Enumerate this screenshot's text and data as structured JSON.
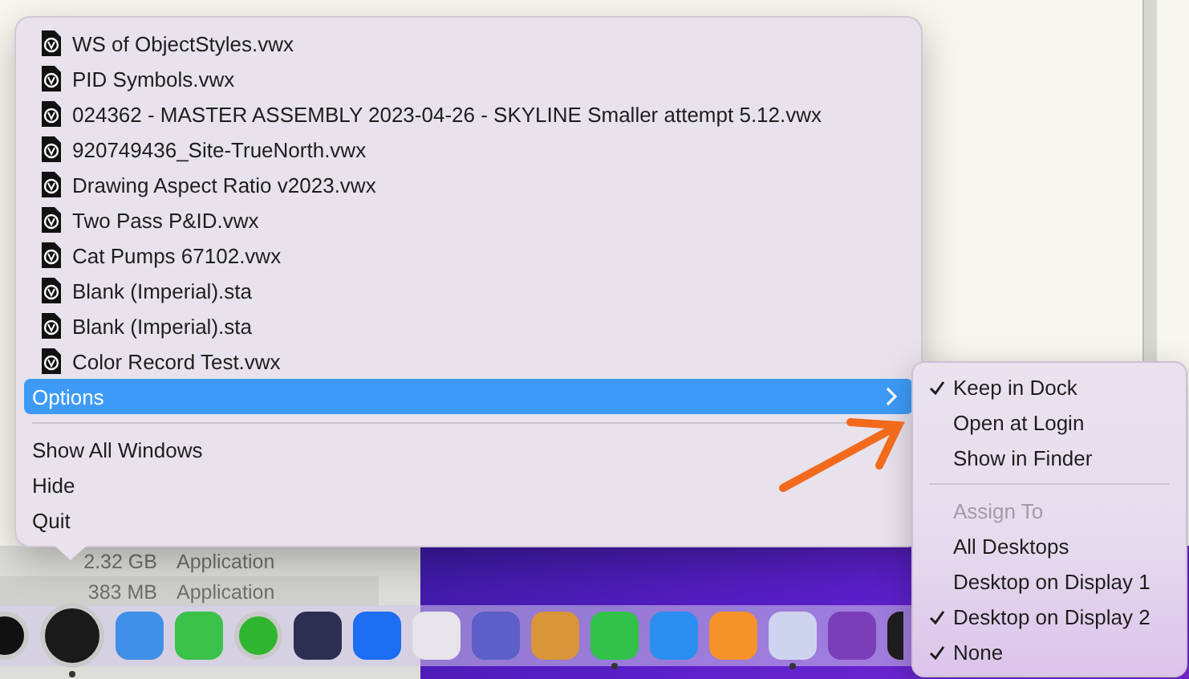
{
  "menu": {
    "recent_files": [
      {
        "label": "WS of ObjectStyles.vwx"
      },
      {
        "label": "PID Symbols.vwx"
      },
      {
        "label": "024362 - MASTER ASSEMBLY 2023-04-26 - SKYLINE Smaller attempt 5.12.vwx"
      },
      {
        "label": "920749436_Site-TrueNorth.vwx"
      },
      {
        "label": "Drawing Aspect Ratio v2023.vwx"
      },
      {
        "label": "Two Pass P&ID.vwx"
      },
      {
        "label": "Cat Pumps 67102.vwx"
      },
      {
        "label": "Blank (Imperial).sta"
      },
      {
        "label": "Blank (Imperial).sta"
      },
      {
        "label": "Color Record Test.vwx"
      }
    ],
    "options": {
      "label": "Options",
      "selected": true
    },
    "commands": [
      {
        "label": "Show All Windows"
      },
      {
        "label": "Hide"
      },
      {
        "label": "Quit"
      }
    ]
  },
  "submenu": {
    "items": [
      {
        "label": "Keep in Dock",
        "checked": true
      },
      {
        "label": "Open at Login",
        "checked": false
      },
      {
        "label": "Show in Finder",
        "checked": false
      }
    ],
    "section_header": "Assign To",
    "desktops": [
      {
        "label": "All Desktops",
        "checked": false
      },
      {
        "label": "Desktop on Display 1",
        "checked": false
      },
      {
        "label": "Desktop on Display 2",
        "checked": true
      },
      {
        "label": "None",
        "checked": true
      }
    ]
  },
  "finder_rows": [
    {
      "size": "2.32 GB",
      "kind": "Application"
    },
    {
      "size": "383 MB",
      "kind": "Application"
    }
  ],
  "dock": [
    {
      "kind": "disc",
      "color": "#111111",
      "running": false
    },
    {
      "kind": "disc",
      "color": "#1a1a1a",
      "running": true
    },
    {
      "kind": "tile",
      "color": "#3f8fe8",
      "running": false
    },
    {
      "kind": "tile",
      "color": "#3ac24a",
      "running": false
    },
    {
      "kind": "blob",
      "color": "#2fb52f",
      "running": false
    },
    {
      "kind": "tile",
      "color": "#2d2f52",
      "running": false
    },
    {
      "kind": "tile",
      "color": "#1c6df2",
      "running": false
    },
    {
      "kind": "tile",
      "color": "#e8e4ec",
      "running": false
    },
    {
      "kind": "tile",
      "color": "#5b5fc7",
      "running": false
    },
    {
      "kind": "tile",
      "color": "#d9953a",
      "running": false
    },
    {
      "kind": "tile",
      "color": "#31c24a",
      "running": true
    },
    {
      "kind": "tile",
      "color": "#2a8ff0",
      "running": false
    },
    {
      "kind": "tile",
      "color": "#f5922a",
      "running": false
    },
    {
      "kind": "tile",
      "color": "#cfd4ee",
      "running": true
    },
    {
      "kind": "tile",
      "color": "#7a3fb8",
      "running": false
    },
    {
      "kind": "edge",
      "color": "#1e1e1e",
      "running": false
    }
  ]
}
